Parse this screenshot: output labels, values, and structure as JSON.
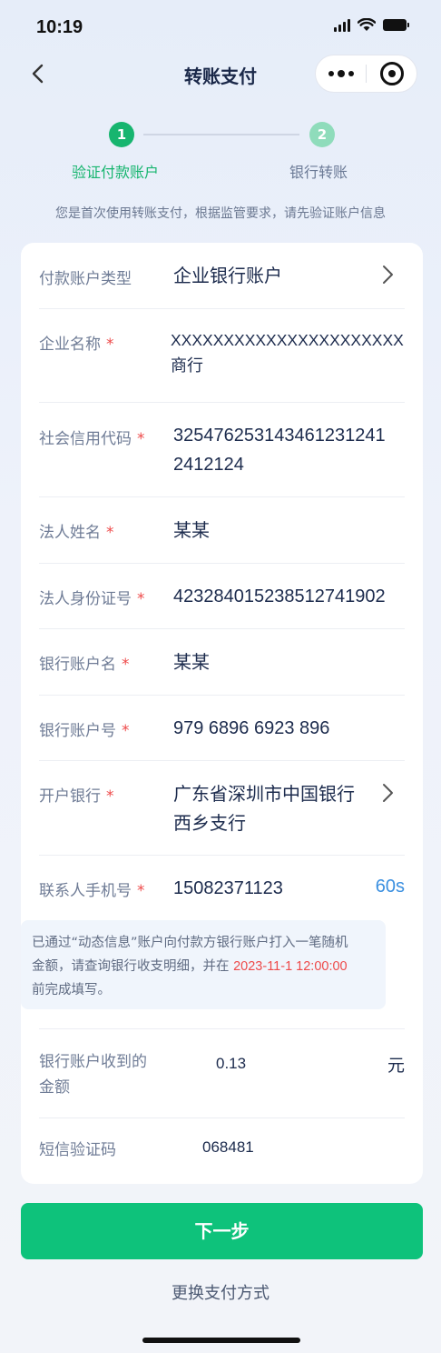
{
  "status_bar": {
    "time": "10:19"
  },
  "nav": {
    "title": "转账支付"
  },
  "steps": [
    {
      "number": "1",
      "label": "验证付款账户"
    },
    {
      "number": "2",
      "label": "银行转账"
    }
  ],
  "notice": "您是首次使用转账支付，根据监管要求，请先验证账户信息",
  "form": {
    "account_type": {
      "label": "付款账户类型",
      "value": "企业银行账户"
    },
    "company_name": {
      "label": "企业名称",
      "required": "*",
      "value_line1": "XXXXXXXXXXXXXXXXXXXXXX",
      "value_line2": "商行"
    },
    "credit_code": {
      "label": "社会信用代码",
      "required": "*",
      "value_line1": "325476253143461231241",
      "value_line2": "2412124"
    },
    "legal_name": {
      "label": "法人姓名",
      "required": "*",
      "value": "某某"
    },
    "legal_id": {
      "label": "法人身份证号",
      "required": "*",
      "value": "423284015238512741902"
    },
    "account_name": {
      "label": "银行账户名",
      "required": "*",
      "value": "某某"
    },
    "account_number": {
      "label": "银行账户号",
      "required": "*",
      "value": "979 6896 6923 896"
    },
    "bank": {
      "label": "开户银行",
      "required": "*",
      "value_line1": "广东省深圳市中国银行",
      "value_line2": "西乡支行"
    },
    "phone": {
      "label": "联系人手机号",
      "required": "*",
      "value": "15082371123",
      "countdown": "60s"
    },
    "hint": {
      "line1": "已通过“动态信息”账户向付款方银行账户打入一笔随机",
      "line2_prefix": "金额，请查询银行收支明细，并在 ",
      "deadline": "2023-11-1 12:00:00",
      "line3": "前完成填写。"
    },
    "amount": {
      "label_line1": "银行账户收到的",
      "label_line2": "金额",
      "value": "0.13",
      "unit": "元"
    },
    "sms_code": {
      "label": "短信验证码",
      "value": "068481"
    }
  },
  "actions": {
    "next_label": "下一步",
    "switch_label": "更换支付方式"
  },
  "colors": {
    "primary_green": "#0ec27b",
    "step_green": "#17b56f",
    "required_red": "#ee4a4a",
    "countdown_blue": "#3a8fe0"
  }
}
